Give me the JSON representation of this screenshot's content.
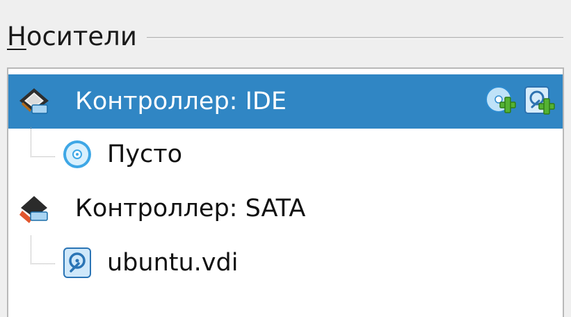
{
  "storage": {
    "title_mnemonic": "Н",
    "title_rest": "осители"
  },
  "tree": {
    "controllers": [
      {
        "label": "Контроллер: IDE",
        "icon": "ide-controller-icon",
        "selected": true,
        "actions": [
          {
            "icon": "add-optical-drive-icon"
          },
          {
            "icon": "add-hard-disk-icon"
          }
        ],
        "attachments": [
          {
            "label": "Пусто",
            "icon": "optical-disc-icon"
          }
        ]
      },
      {
        "label": "Контроллер: SATA",
        "icon": "sata-controller-icon",
        "selected": false,
        "attachments": [
          {
            "label": "ubuntu.vdi",
            "icon": "hard-disk-icon"
          }
        ]
      }
    ]
  },
  "colors": {
    "selection": "#3086c4",
    "add_badge": "#4caf2e",
    "disc": "#3ea7e6"
  }
}
